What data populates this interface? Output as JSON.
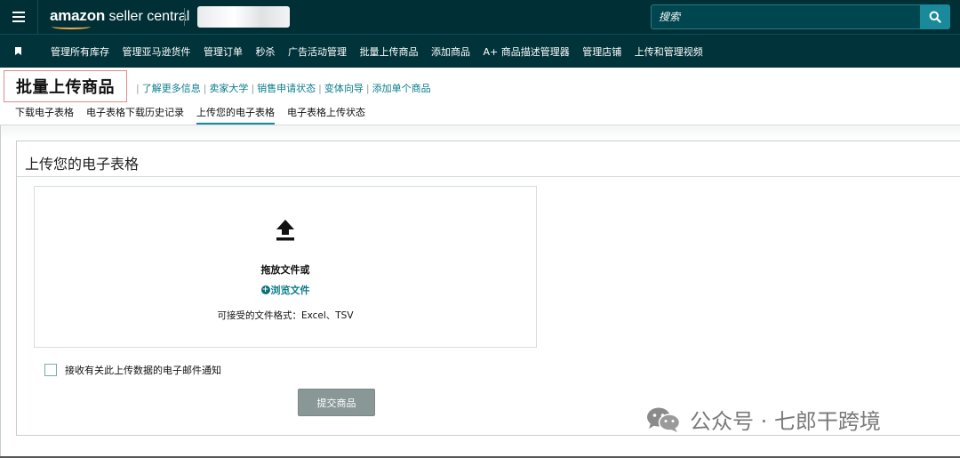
{
  "header": {
    "logo_amazon": "amazon",
    "logo_product": " seller central",
    "search_placeholder": "搜索"
  },
  "nav": {
    "items": [
      "管理所有库存",
      "管理亚马逊货件",
      "管理订单",
      "秒杀",
      "广告活动管理",
      "批量上传商品",
      "添加商品",
      "A+ 商品描述管理器",
      "管理店铺",
      "上传和管理视频"
    ]
  },
  "page": {
    "title": "批量上传商品",
    "links": [
      "了解更多信息",
      "卖家大学",
      "销售申请状态",
      "变体向导",
      "添加单个商品"
    ]
  },
  "tabs": [
    "下载电子表格",
    "电子表格下载历史记录",
    "上传您的电子表格",
    "电子表格上传状态"
  ],
  "active_tab_index": 2,
  "card": {
    "title": "上传您的电子表格",
    "drag_text": "拖放文件或",
    "browse_text": "浏览文件",
    "formats_text": "可接受的文件格式：Excel、TSV",
    "email_label": "接收有关此上传数据的电子邮件通知",
    "email_checked": false,
    "submit_label": "提交商品"
  },
  "watermark": {
    "text": "公众号 · 七郎干跨境"
  },
  "colors": {
    "header_bg": "#002f36",
    "nav_bg": "#01333a",
    "accent": "#1a8a9b",
    "link": "#0a7d8c",
    "submit_bg": "#8a9797"
  }
}
